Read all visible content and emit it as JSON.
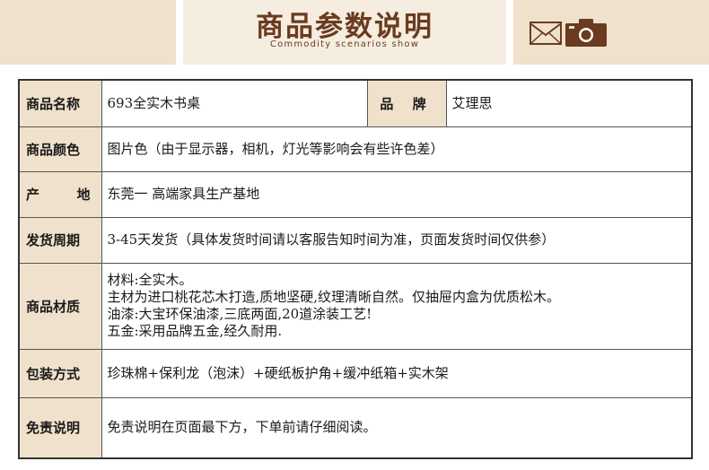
{
  "header": {
    "title": "商品参数说明",
    "subtitle": "Commodity scenarios show",
    "icons": [
      "envelope-icon",
      "camera-icon"
    ],
    "colors": {
      "banner": "#efe1cc",
      "title": "#6b3b1f",
      "label_bg": "#efe1cc"
    }
  },
  "spec": {
    "name_label": "商品名称",
    "name_value": "693全实木书桌",
    "brand_label": "品 牌",
    "brand_value": "艾理思",
    "color_label": "商品颜色",
    "color_value": "图片色（由于显示器，相机，灯光等影响会有些许色差）",
    "origin_label": "产 地",
    "origin_value": "东莞一 高端家具生产基地",
    "delivery_label": "发货周期",
    "delivery_value": "3-45天发货（具体发货时间请以客服告知时间为准，页面发货时间仅供参）",
    "material_label": "商品材质",
    "material_lines": [
      "材料:全实木。",
      "主材为进口桃花芯木打造,质地坚硬,纹理清晰自然。仅抽屉内盒为优质松木。",
      "油漆:大宝环保油漆,三底两面,20道涂装工艺!",
      "五金:采用品牌五金,经久耐用."
    ],
    "packaging_label": "包装方式",
    "packaging_value": "珍珠棉+保利龙（泡沫）+硬纸板护角+缓冲纸箱+实木架",
    "disclaimer_label": "免责说明",
    "disclaimer_value": "免责说明在页面最下方，下单前请仔细阅读。"
  }
}
